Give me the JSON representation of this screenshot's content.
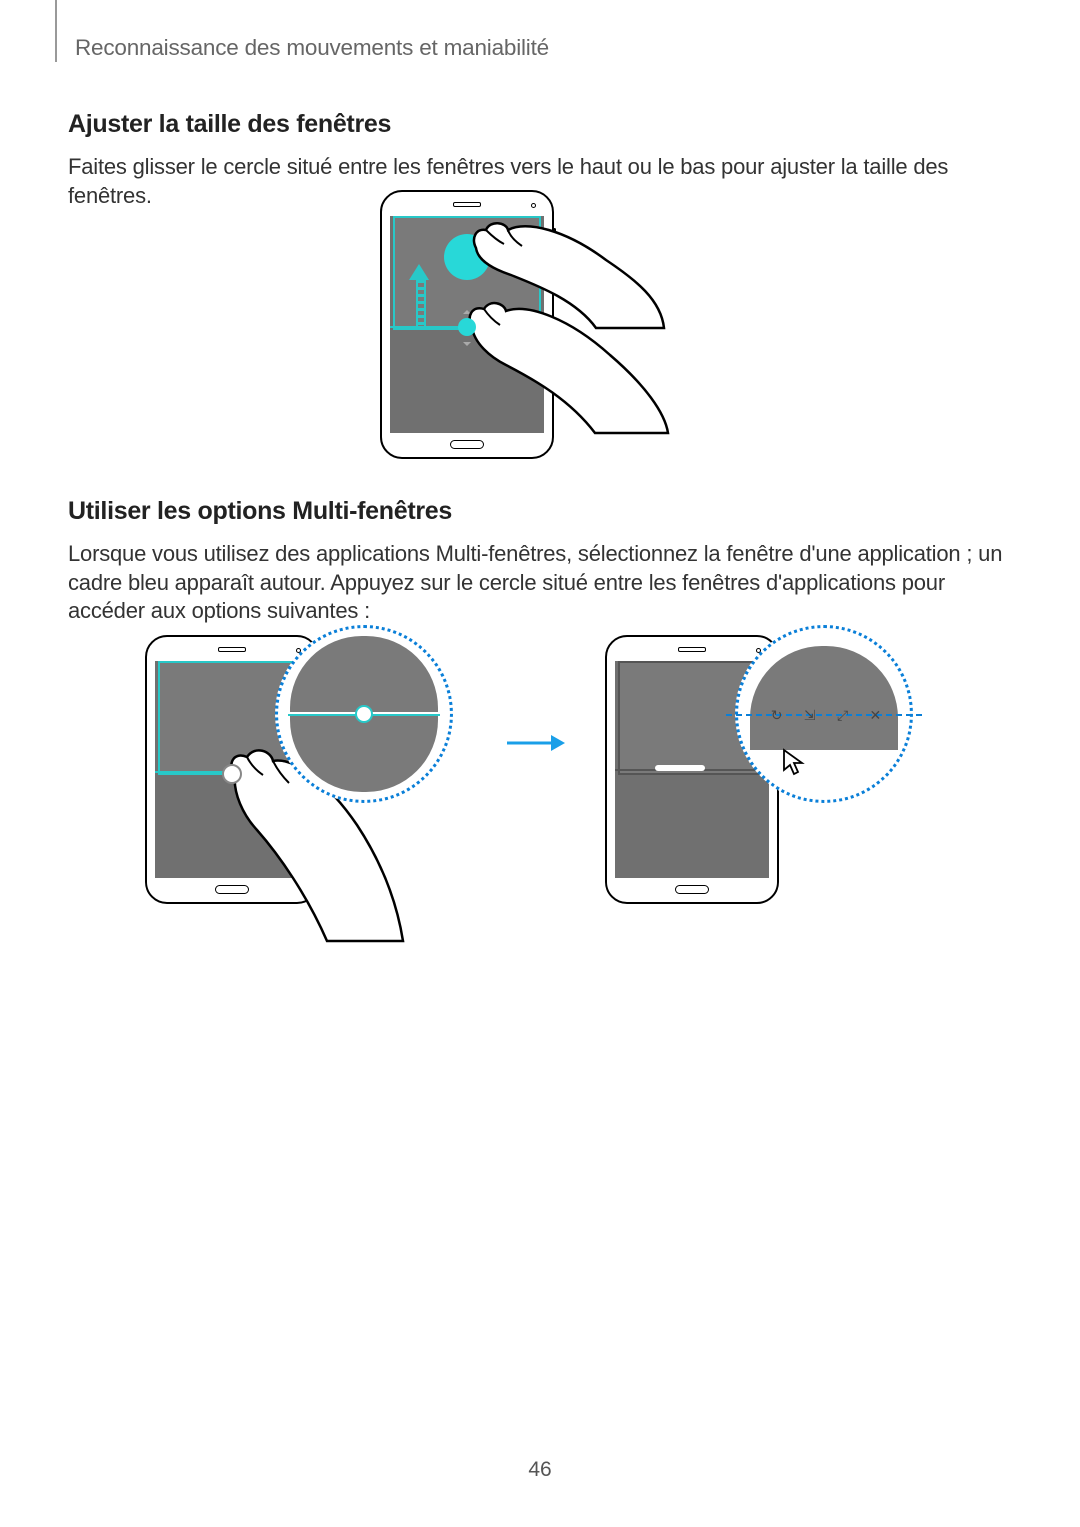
{
  "header": {
    "breadcrumb": "Reconnaissance des mouvements et maniabilité"
  },
  "section1": {
    "title": "Ajuster la taille des fenêtres",
    "body": "Faites glisser le cercle situé entre les fenêtres vers le haut ou le bas pour ajuster la taille des fenêtres."
  },
  "section2": {
    "title": "Utiliser les options Multi-fenêtres",
    "body": "Lorsque vous utilisez des applications Multi-fenêtres, sélectionnez la fenêtre d'une application ; un cadre bleu apparaît autour. Appuyez sur le cercle situé entre les fenêtres d'applications pour accéder aux options suivantes :"
  },
  "page_number": "46"
}
